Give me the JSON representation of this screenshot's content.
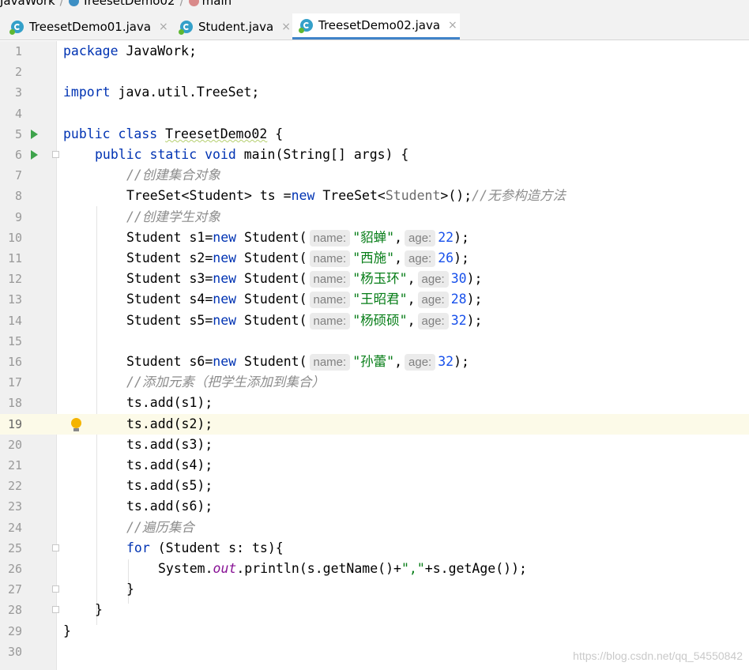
{
  "breadcrumb": {
    "project": "JavaWork",
    "file": "TreesetDemo02",
    "method": "main"
  },
  "tabs": [
    {
      "label": "TreesetDemo01.java",
      "close": "×"
    },
    {
      "label": "Student.java",
      "close": "×"
    },
    {
      "label": "TreesetDemo02.java",
      "close": "×"
    }
  ],
  "active_tab": "TreesetDemo02.java",
  "lines": {
    "l1": {
      "kw": "package",
      "rest": " JavaWork;"
    },
    "l3": {
      "kw": "import",
      "rest": " java.util.TreeSet;"
    },
    "l5": {
      "kw": "public class",
      "name": "TreesetDemo02",
      "rest": " {"
    },
    "l6": {
      "kw": "public static void",
      "rest": " main(String[] args) {"
    },
    "l7": {
      "comment": "//创建集合对象"
    },
    "l8": {
      "a": "TreeSet<Student> ts =",
      "kw": "new",
      "b": " TreeSet<",
      "gen": "Student",
      "c": ">();",
      "comment": "//无参构造方法"
    },
    "l9": {
      "comment": "//创建学生对象"
    },
    "l16": {
      "a": "Student s6=",
      "kw": "new",
      "b": " Student(",
      "name_hint": "name:",
      "str": "\"孙蕾\"",
      "comma": ",",
      "age_hint": "age:",
      "num": "32",
      "end": ");"
    },
    "l17": {
      "comment": "//添加元素（把学生添加到集合）"
    },
    "l24": {
      "comment": "//遍历集合"
    },
    "l25": {
      "kw": "for",
      "rest": " (Student s: ts){"
    },
    "l26": {
      "a": "System.",
      "fld": "out",
      "b": ".println(s.getName()+",
      "str": "\",\"",
      "c": "+s.getAge());"
    },
    "l27": {
      "text": "}"
    },
    "l28": {
      "text": "}"
    },
    "l29": {
      "text": "}"
    }
  },
  "students": [
    {
      "decl": "Student s1=",
      "kw": "new",
      "ctor": " Student(",
      "name_hint": "name:",
      "name": "\"貂蝉\"",
      "comma": ",",
      "age_hint": "age:",
      "age": "22",
      "end": ");"
    },
    {
      "decl": "Student s2=",
      "kw": "new",
      "ctor": " Student(",
      "name_hint": "name:",
      "name": "\"西施\"",
      "comma": ",",
      "age_hint": "age:",
      "age": "26",
      "end": ");"
    },
    {
      "decl": "Student s3=",
      "kw": "new",
      "ctor": " Student(",
      "name_hint": "name:",
      "name": "\"杨玉环\"",
      "comma": ",",
      "age_hint": "age:",
      "age": "30",
      "end": ");"
    },
    {
      "decl": "Student s4=",
      "kw": "new",
      "ctor": " Student(",
      "name_hint": "name:",
      "name": "\"王昭君\"",
      "comma": ",",
      "age_hint": "age:",
      "age": "28",
      "end": ");"
    },
    {
      "decl": "Student s5=",
      "kw": "new",
      "ctor": " Student(",
      "name_hint": "name:",
      "name": "\"杨硕硕\"",
      "comma": ",",
      "age_hint": "age:",
      "age": "32",
      "end": ");"
    }
  ],
  "adds": [
    "ts.add(s1);",
    "ts.add(s2);",
    "ts.add(s3);",
    "ts.add(s4);",
    "ts.add(s5);",
    "ts.add(s6);"
  ],
  "line_numbers": [
    "1",
    "2",
    "3",
    "4",
    "5",
    "6",
    "7",
    "8",
    "9",
    "10",
    "11",
    "12",
    "13",
    "14",
    "15",
    "16",
    "17",
    "18",
    "19",
    "20",
    "21",
    "22",
    "23",
    "24",
    "25",
    "26",
    "27",
    "28",
    "29",
    "30"
  ],
  "current_line": "19",
  "watermark": "https://blog.csdn.net/qq_54550842",
  "colors": {
    "keyword": "#0033b3",
    "string": "#067d17",
    "number": "#1750eb",
    "comment": "#8c8c8c",
    "field": "#871094",
    "tab_accent": "#4083c9",
    "current_line_bg": "#fcfae8"
  },
  "icons": [
    "java-class-icon",
    "run-gutter-icon",
    "fold-marker-icon",
    "intention-bulb-icon",
    "close-tab-icon"
  ]
}
